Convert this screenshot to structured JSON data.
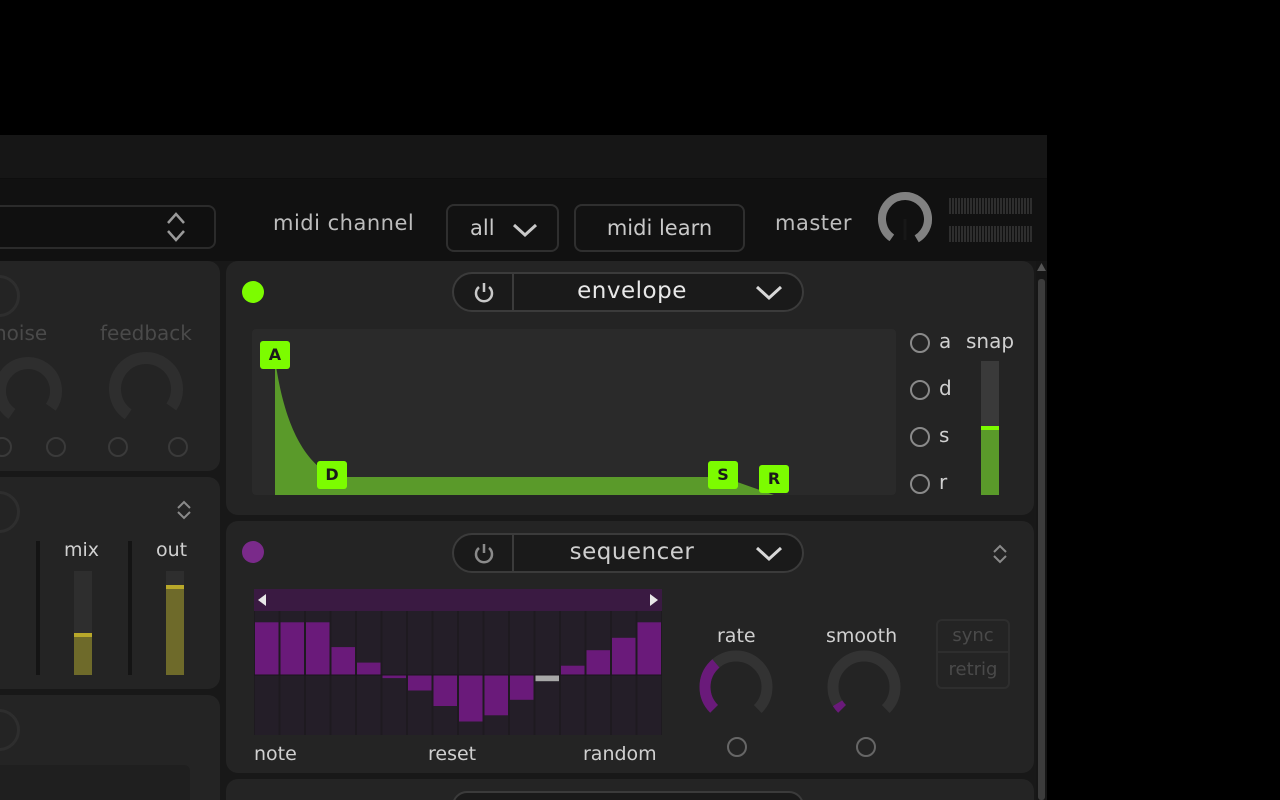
{
  "header": {
    "midi_channel_label": "midi channel",
    "midi_channel_value": "all",
    "midi_learn_label": "midi learn",
    "master_label": "master"
  },
  "left_panel": {
    "knob1_label": "noise",
    "knob2_label": "feedback",
    "mix_label": "mix",
    "out_label": "out"
  },
  "envelope": {
    "module_name": "envelope",
    "status_color": "#7cfc00",
    "point_labels": [
      "A",
      "D",
      "S",
      "R"
    ],
    "radio_labels": [
      "a",
      "d",
      "s",
      "r"
    ],
    "snap_label": "snap",
    "snap_level": 0.5,
    "accent": "#7cfc00",
    "fill": "#5a9a2a"
  },
  "sequencer": {
    "module_name": "sequencer",
    "status_color": "#7a2a8a",
    "accent": "#6a1a7a",
    "steps": [
      0.85,
      0.85,
      0.85,
      0.45,
      0.2,
      -0.05,
      -0.25,
      -0.5,
      -0.75,
      -0.65,
      -0.4,
      -0.1,
      0.15,
      0.4,
      0.6,
      0.85
    ],
    "highlighted_step": 11,
    "note_label": "note",
    "reset_label": "reset",
    "random_label": "random",
    "rate_label": "rate",
    "smooth_label": "smooth",
    "rate_value": 0.35,
    "smooth_value": 0.05,
    "sync_label": "sync",
    "retrig_label": "retrig"
  },
  "colors": {
    "background": "#000000",
    "panel": "#242424",
    "envelope_accent": "#7cfc00",
    "sequencer_accent": "#6a1a7a",
    "meter_yellow": "#8a8a2a"
  }
}
